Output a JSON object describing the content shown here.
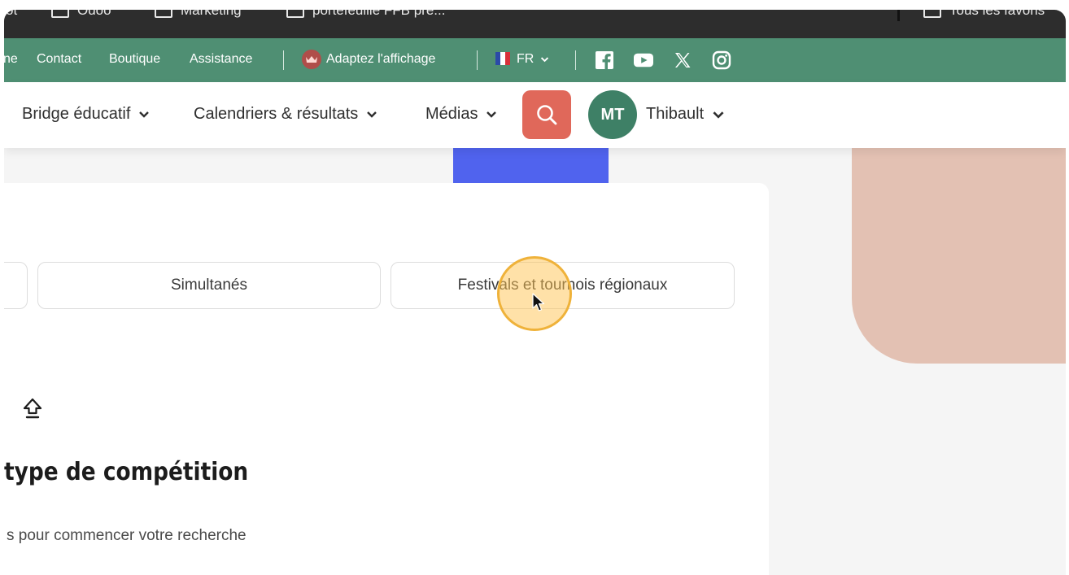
{
  "bookmarks": {
    "items": [
      {
        "label": "ot",
        "has_folder": false
      },
      {
        "label": "Odoo",
        "has_folder": true
      },
      {
        "label": "Marketing",
        "has_folder": true
      },
      {
        "label": "portefeuille FFB pre...",
        "has_folder": true
      }
    ],
    "all_bookmarks": "Tous les favoris"
  },
  "topbar": {
    "links": [
      "ne",
      "Contact",
      "Boutique",
      "Assistance"
    ],
    "accessibility": "Adaptez l'affichage",
    "language": "FR"
  },
  "nav": {
    "items": [
      {
        "label": "Bridge éducatif"
      },
      {
        "label": "Calendriers & résultats"
      },
      {
        "label": "Médias"
      }
    ],
    "avatar_initials": "MT",
    "user_name": "Thibault"
  },
  "filters": {
    "chips": [
      {
        "label": ""
      },
      {
        "label": "Simultanés"
      },
      {
        "label": "Festivals et tournois régionaux"
      }
    ]
  },
  "section": {
    "heading": "type de compétition",
    "subtext": "s pour commencer votre recherche"
  },
  "colors": {
    "green_bar": "#4f8f73",
    "search_button": "#e0685a",
    "avatar": "#3e8066",
    "blue_block": "#5063ee",
    "pink_card": "#e3c1b3"
  }
}
